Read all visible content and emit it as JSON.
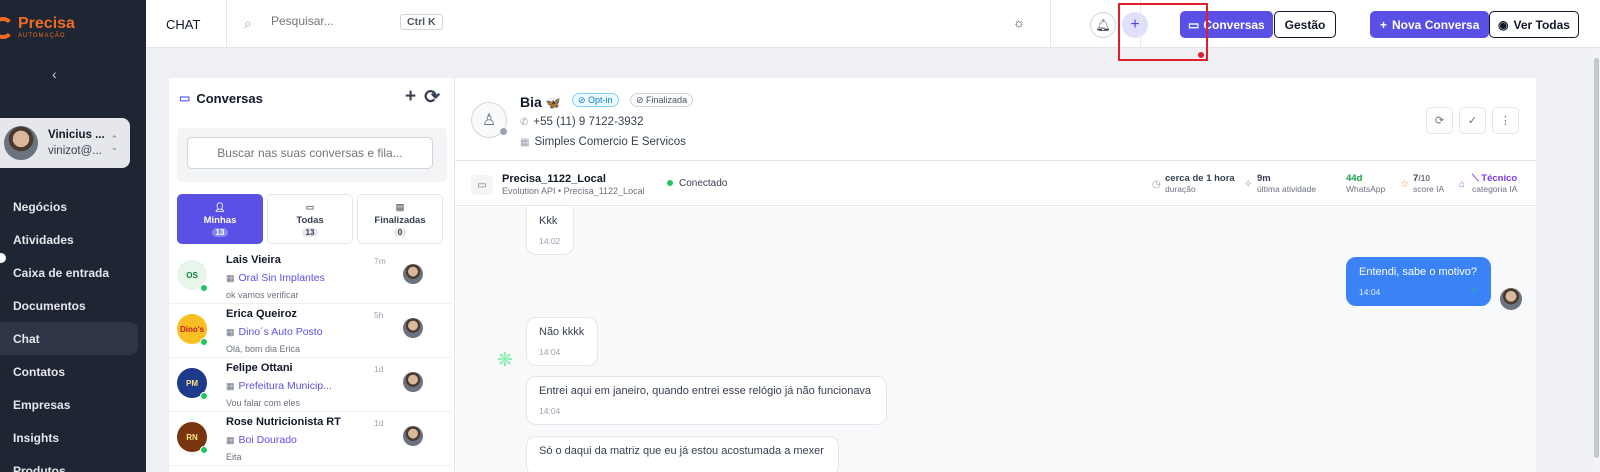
{
  "brand": {
    "name": "Precisa",
    "tagline": "AUTOMAÇÃO"
  },
  "user": {
    "name": "Vinicius ...",
    "email": "vinizot@..."
  },
  "nav": [
    {
      "label": "Negócios"
    },
    {
      "label": "Atividades"
    },
    {
      "label": "Caixa de entrada"
    },
    {
      "label": "Documentos"
    },
    {
      "label": "Chat",
      "active": true
    },
    {
      "label": "Contatos"
    },
    {
      "label": "Empresas"
    },
    {
      "label": "Insights"
    },
    {
      "label": "Produtos"
    }
  ],
  "topbar": {
    "title": "CHAT",
    "search_placeholder": "Pesquisar...",
    "shortcut": "Ctrl K",
    "buttons": {
      "conversas": "Conversas",
      "gestao": "Gestão",
      "nova": "Nova Conversa",
      "ver_todas": "Ver Todas"
    }
  },
  "conv_panel": {
    "title": "Conversas",
    "search_placeholder": "Buscar nas suas conversas e fila...",
    "tabs": [
      {
        "label": "Minhas",
        "count": "13"
      },
      {
        "label": "Todas",
        "count": "13"
      },
      {
        "label": "Finalizadas",
        "count": "0"
      }
    ],
    "items": [
      {
        "name": "Lais Vieira",
        "company": "Oral Sin Implantes",
        "preview": "ok vamos verificar",
        "time": "7m",
        "logo": "OS",
        "logo_bg": "#e8f5e9",
        "logo_color": "#15803d"
      },
      {
        "name": "Erica Queiroz",
        "company": "Dino´s Auto Posto",
        "preview": "Olá, bom dia Erica",
        "time": "5h",
        "logo": "Dino's",
        "logo_bg": "#fbbf24",
        "logo_color": "#b91c1c"
      },
      {
        "name": "Felipe Ottani",
        "company": "Prefeitura Municip...",
        "preview": "Vou falar com eles",
        "time": "1d",
        "logo": "PM",
        "logo_bg": "#1e3a8a",
        "logo_color": "#fde68a"
      },
      {
        "name": "Rose Nutricionista RT",
        "company": "Boi Dourado",
        "preview": "Eita",
        "time": "1d",
        "logo": "RN",
        "logo_bg": "#78350f",
        "logo_color": "#fde68a"
      }
    ]
  },
  "contact": {
    "name": "Bia",
    "emoji": "🦋",
    "badges": {
      "optin": "Opt-in",
      "finalizada": "Finalizada"
    },
    "phone": "+55 (11) 9 7122-3932",
    "company": "Simples Comercio E Servicos"
  },
  "connection": {
    "name": "Precisa_1122_Local",
    "sub": "Evolution API • Precisa_1122_Local",
    "status": "Conectado",
    "metrics": [
      {
        "value": "cerca de 1 hora",
        "label": "duração"
      },
      {
        "value": "9m",
        "label": "última atividade"
      },
      {
        "value": "44d",
        "label": "WhatsApp"
      },
      {
        "value": "7",
        "value_suffix": "/10",
        "label": "score IA"
      },
      {
        "value": "Técnico",
        "label": "categoria IA"
      }
    ]
  },
  "messages": [
    {
      "text": "Kkk",
      "time": "14:02",
      "dir": "in"
    },
    {
      "text": "Entendi, sabe o motivo?",
      "time": "14:04",
      "dir": "out"
    },
    {
      "text": "Não kkkk",
      "time": "14:04",
      "dir": "in"
    },
    {
      "text": "Entrei aqui em janeiro, quando entrei esse relógio já não funcionava",
      "time": "14:04",
      "dir": "in"
    },
    {
      "text": "Só o daqui da matriz que eu já estou acostumada a mexer",
      "time": "",
      "dir": "in"
    }
  ],
  "colors": {
    "primary": "#5b50e6",
    "sidebar": "#1e2533",
    "brand": "#f26b21",
    "outgoing": "#3b82f6",
    "highlight": "#e11d2b"
  }
}
